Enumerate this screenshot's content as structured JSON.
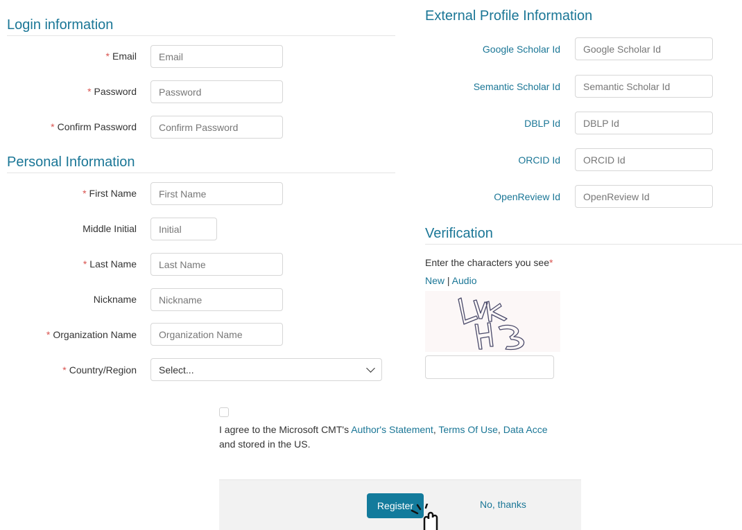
{
  "login": {
    "title": "Login information",
    "fields": [
      {
        "label": "Email",
        "placeholder": "Email",
        "required": "*"
      },
      {
        "label": "Password",
        "placeholder": "Password",
        "required": "*"
      },
      {
        "label": "Confirm Password",
        "placeholder": "Confirm Password",
        "required": "*"
      }
    ]
  },
  "personal": {
    "title": "Personal Information",
    "fields": [
      {
        "label": "First Name",
        "placeholder": "First Name",
        "required": "*"
      },
      {
        "label": "Middle Initial",
        "placeholder": "Initial"
      },
      {
        "label": "Last Name",
        "placeholder": "Last Name",
        "required": "*"
      },
      {
        "label": "Nickname",
        "placeholder": "Nickname"
      },
      {
        "label": "Organization Name",
        "placeholder": "Organization Name",
        "required": "*"
      },
      {
        "label": "Country/Region",
        "selected": "Select...",
        "required": "*"
      }
    ]
  },
  "external": {
    "title": "External Profile Information",
    "fields": [
      {
        "label": "Google Scholar Id",
        "placeholder": "Google Scholar Id"
      },
      {
        "label": "Semantic Scholar Id",
        "placeholder": "Semantic Scholar Id"
      },
      {
        "label": "DBLP Id",
        "placeholder": "DBLP Id"
      },
      {
        "label": "ORCID Id",
        "placeholder": "ORCID Id"
      },
      {
        "label": "OpenReview Id",
        "placeholder": "OpenReview Id"
      }
    ]
  },
  "verification": {
    "title": "Verification",
    "prompt": "Enter the characters you see",
    "required": "*",
    "new_link": "New",
    "separator": " | ",
    "audio_link": "Audio",
    "captcha_text": "LVK H3"
  },
  "agreement": {
    "prefix": "I agree to the Microsoft CMT's ",
    "link_author": "Author's Statement",
    "comma1": ", ",
    "link_terms": "Terms Of Use",
    "comma2": ", ",
    "link_data": "Data Acce",
    "suffix": "and stored in the US."
  },
  "actions": {
    "register": "Register",
    "no_thanks": "No, thanks"
  },
  "colors": {
    "accent": "#1a7696",
    "button": "#137b9c",
    "required": "#d9534f"
  }
}
